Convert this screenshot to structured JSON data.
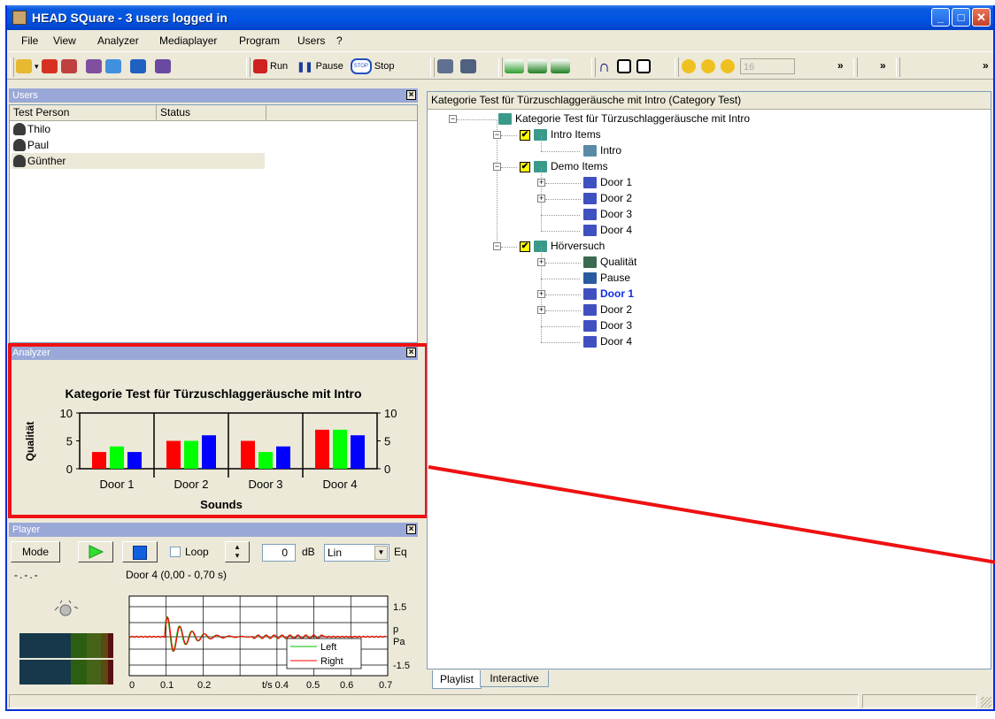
{
  "window": {
    "title": "HEAD SQuare - 3 users logged in",
    "min": "_",
    "max": "□",
    "close": "✕"
  },
  "menu": [
    "File",
    "View",
    "Analyzer",
    "Mediaplayer",
    "Program",
    "Users",
    "?"
  ],
  "toolbar": {
    "run": "Run",
    "pause": "Pause",
    "stop": "Stop",
    "stop_icon_text": "STOP",
    "counter": "16",
    "overflow": "»"
  },
  "users": {
    "title": "Users",
    "columns": [
      "Test Person",
      "Status"
    ],
    "rows": [
      {
        "name": "Thilo"
      },
      {
        "name": "Paul"
      },
      {
        "name": "Günther"
      }
    ]
  },
  "analyzer": {
    "title": "Analyzer"
  },
  "chart_data": {
    "type": "bar",
    "title": "Kategorie Test für Türzuschlaggeräusche mit Intro",
    "xlabel": "Sounds",
    "ylabel": "Qualität",
    "ylim": [
      0,
      10
    ],
    "yticks": [
      0,
      5,
      10
    ],
    "categories": [
      "Door 1",
      "Door 2",
      "Door 3",
      "Door 4"
    ],
    "series": [
      {
        "values": [
          3,
          5,
          5,
          7
        ],
        "color": "#ff0000"
      },
      {
        "values": [
          4,
          5,
          3,
          7
        ],
        "color": "#00ff00"
      },
      {
        "values": [
          3,
          6,
          4,
          6
        ],
        "color": "#0000ff"
      }
    ]
  },
  "player": {
    "title": "Player",
    "mode": "Mode",
    "loop": "Loop",
    "gain": "0",
    "unit": "dB",
    "scale": "Lin",
    "eq": "Eq",
    "time_display": "-.-.-",
    "file": "Door 4 (0,00 - 0,70 s)",
    "waveform": {
      "x_ticks": [
        "0",
        "0.1",
        "0.2",
        "t/s 0.4",
        "0.5",
        "0.6",
        "0.7"
      ],
      "y_ticks": [
        "1.5",
        "p",
        "Pa",
        "-1.5"
      ],
      "legend": [
        "Left",
        "Right"
      ],
      "left_color": "#00c000",
      "right_color": "#ff0000"
    }
  },
  "playlist": {
    "header": "Kategorie Test für Türzuschlaggeräusche mit Intro (Category Test)",
    "root": "Kategorie Test für Türzuschlaggeräusche mit Intro",
    "intro_group": "Intro Items",
    "intro_item": "Intro",
    "demo_group": "Demo Items",
    "demo_items": [
      "Door 1",
      "Door 2",
      "Door 3",
      "Door 4"
    ],
    "test_group": "Hörversuch",
    "test_items": [
      "Qualität",
      "Pause",
      "Door 1",
      "Door 2",
      "Door 3",
      "Door 4"
    ],
    "checked": "✔",
    "tabs": [
      "Playlist",
      "Interactive"
    ]
  }
}
